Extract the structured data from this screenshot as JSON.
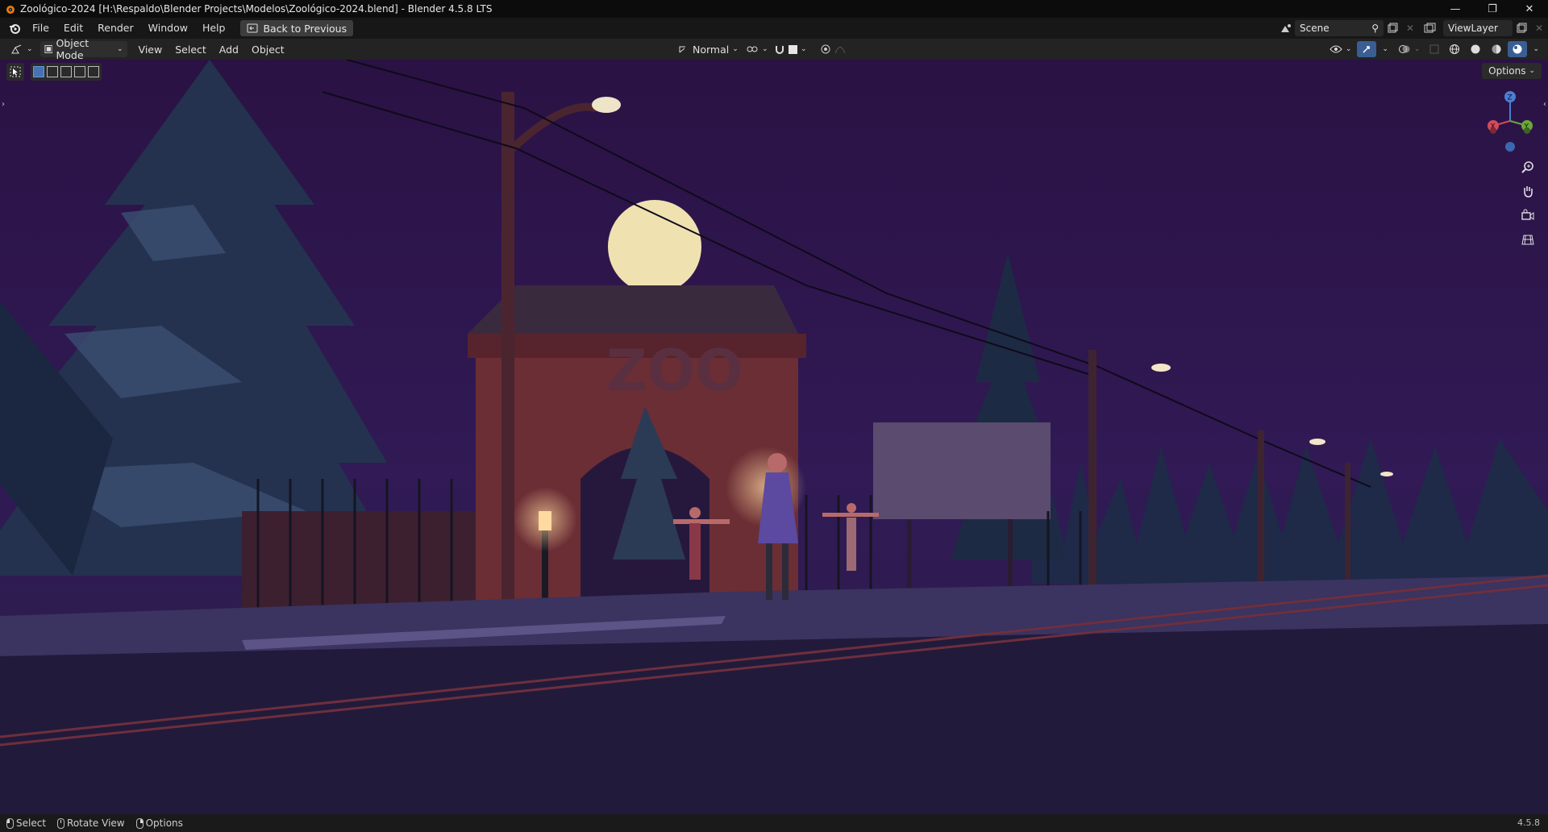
{
  "window": {
    "title": "Zoológico-2024 [H:\\Respaldo\\Blender Projects\\Modelos\\Zoológico-2024.blend] - Blender 4.5.8 LTS",
    "controls": [
      "minimize-icon",
      "restore-icon",
      "close-icon"
    ]
  },
  "menubar": {
    "items": [
      "File",
      "Edit",
      "Render",
      "Window",
      "Help"
    ],
    "back_button": "Back to Previous",
    "scene": "Scene",
    "view_layer": "ViewLayer"
  },
  "header": {
    "mode": "Object Mode",
    "menus": [
      "View",
      "Select",
      "Add",
      "Object"
    ],
    "orientation": "Normal"
  },
  "viewport": {
    "options_label": "Options",
    "gizmo_axes": [
      "Z",
      "Y",
      "X"
    ],
    "scene_text": "ZOO",
    "nav_icons": [
      "zoom-icon",
      "pan-hand-icon",
      "camera-icon",
      "grid-perspective-icon"
    ],
    "colors": {
      "sky": "#2c1548",
      "road": "#221a3a",
      "moon": "#efe2b0",
      "brick": "#6b2e35"
    }
  },
  "statusbar": {
    "items": [
      "Select",
      "Rotate View",
      "Options"
    ],
    "version": "4.5.8"
  }
}
